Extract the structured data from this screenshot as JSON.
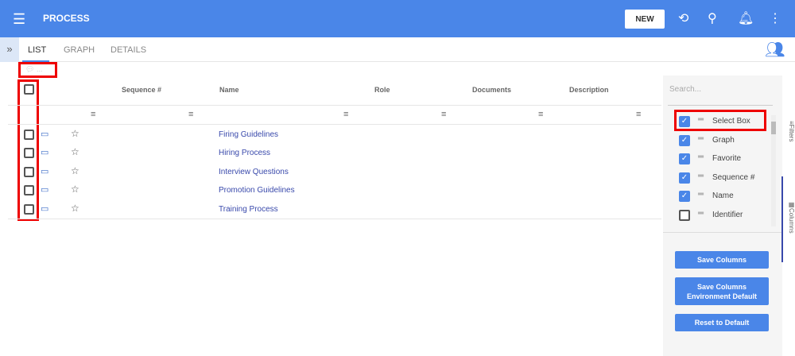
{
  "header": {
    "title": "PROCESS",
    "new_label": "NEW"
  },
  "tabs": [
    "LIST",
    "GRAPH",
    "DETAILS"
  ],
  "comment_placeholder": "...",
  "columns": [
    "Sequence #",
    "Name",
    "Role",
    "Documents",
    "Description"
  ],
  "rows": [
    "Firing Guidelines",
    "Hiring Process",
    "Interview Questions",
    "Promotion Guidelines",
    "Training Process"
  ],
  "side": {
    "search_placeholder": "Search...",
    "columns": [
      {
        "label": "Select Box",
        "checked": true
      },
      {
        "label": "Graph",
        "checked": true
      },
      {
        "label": "Favorite",
        "checked": true
      },
      {
        "label": "Sequence #",
        "checked": true
      },
      {
        "label": "Name",
        "checked": true
      },
      {
        "label": "Identifier",
        "checked": false
      }
    ],
    "save": "Save Columns",
    "save_env_1": "Save Columns",
    "save_env_2": "Environment Default",
    "reset": "Reset to Default",
    "filters_tab": "Filters",
    "columns_tab": "Columns"
  }
}
